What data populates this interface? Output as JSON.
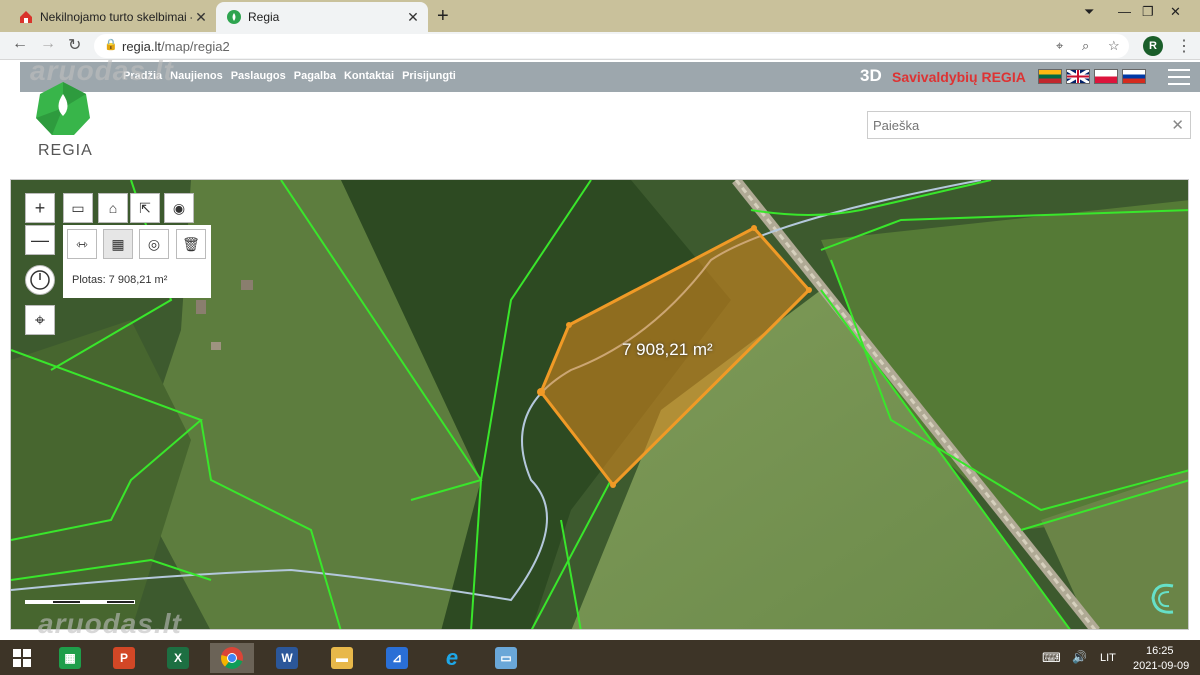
{
  "browser": {
    "tabs": [
      {
        "title": "Nekilnojamo turto skelbimai - Ar"
      },
      {
        "title": "Regia"
      }
    ],
    "url_host": "regia.lt",
    "url_path": "/map/regia2",
    "profile_initial": "R"
  },
  "site": {
    "nav": [
      "Pradžia",
      "Naujienos",
      "Paslaugos",
      "Pagalba",
      "Kontaktai",
      "Prisijungti"
    ],
    "brand_3d": "3D",
    "brand_name": "Savivaldybių REGIA",
    "logo_text": "REGIA",
    "watermark": "aruodas.lt"
  },
  "search": {
    "placeholder": "Paieška"
  },
  "measurement": {
    "readout": "Plotas: 7 908,21 m²",
    "map_label": "7 908,21 m²"
  },
  "taskbar": {
    "language": "LIT",
    "time": "16:25",
    "date": "2021-09-09"
  },
  "colors": {
    "parcel_line": "#39e62b",
    "measure_fill": "#e08a1e",
    "tab_strip": "#c9c19b",
    "nav_bar": "#9da7ad",
    "taskbar": "#3d3427"
  }
}
